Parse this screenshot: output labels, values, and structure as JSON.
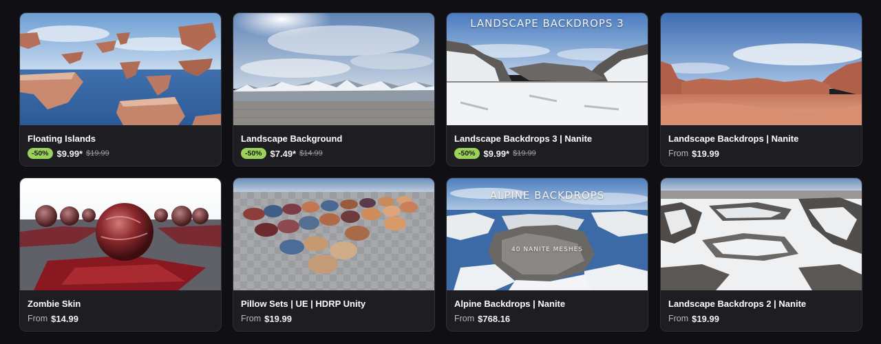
{
  "products": [
    {
      "title": "Floating Islands",
      "discount": "-50%",
      "price": "$9.99*",
      "original": "$19.99"
    },
    {
      "title": "Landscape Background",
      "discount": "-50%",
      "price": "$7.49*",
      "original": "$14.99"
    },
    {
      "title": "Landscape Backdrops 3 | Nanite",
      "discount": "-50%",
      "price": "$9.99*",
      "original": "$19.99",
      "overlay": "LANDSCAPE BACKDROPS 3"
    },
    {
      "title": "Landscape Backdrops | Nanite",
      "from": "From",
      "price": "$19.99"
    },
    {
      "title": "Zombie Skin",
      "from": "From",
      "price": "$14.99"
    },
    {
      "title": "Pillow Sets | UE | HDRP Unity",
      "from": "From",
      "price": "$19.99"
    },
    {
      "title": "Alpine Backdrops | Nanite",
      "from": "From",
      "price": "$768.16",
      "overlay": "ALPINE BACKDROPS",
      "overlay_sub": "40 NANITE MESHES"
    },
    {
      "title": "Landscape Backdrops 2 | Nanite",
      "from": "From",
      "price": "$19.99"
    }
  ],
  "colors": {
    "badge": "#9bd35a",
    "card": "#1d1d22",
    "background": "#101014"
  }
}
